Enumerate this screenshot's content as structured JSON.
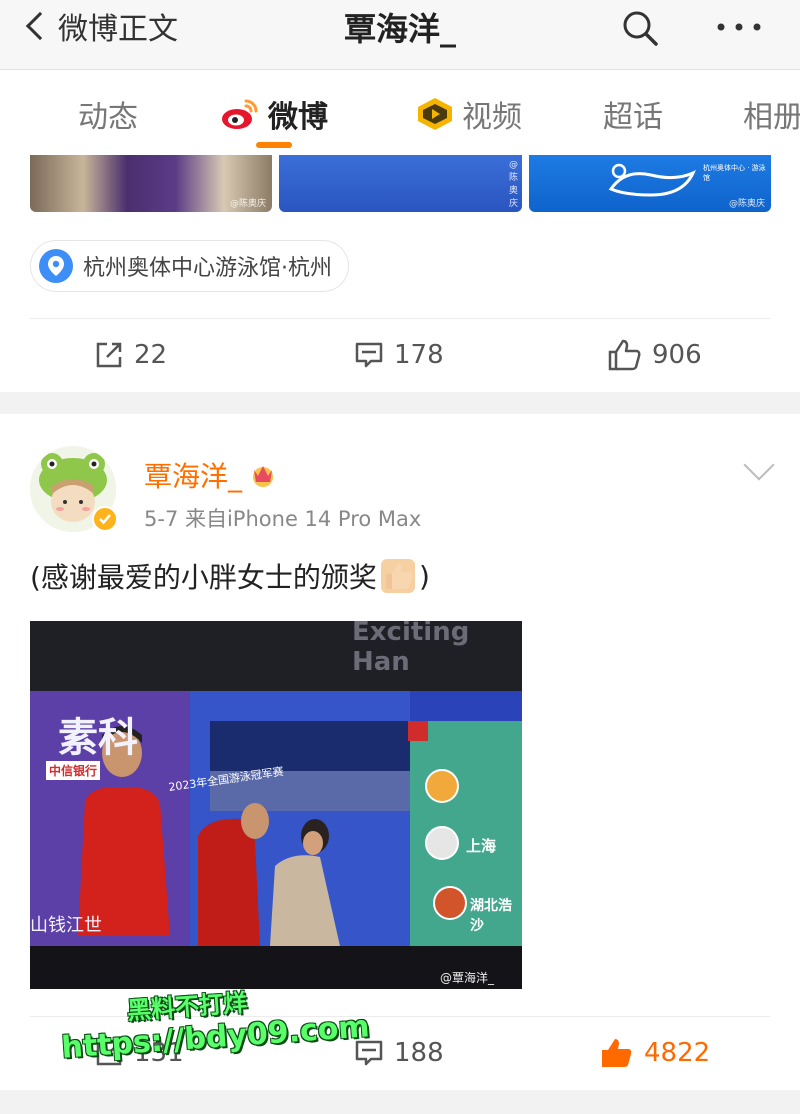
{
  "header": {
    "back_label": "微博正文",
    "title": "覃海洋_"
  },
  "tabs": [
    {
      "label": "动态"
    },
    {
      "label": "微博"
    },
    {
      "label": "视频"
    },
    {
      "label": "超话"
    },
    {
      "label": "相册"
    }
  ],
  "post1": {
    "location": "杭州奥体中心游泳馆·杭州",
    "watermarks": [
      "@陈奥庆",
      "@陈奥庆",
      "@陈奥庆"
    ],
    "banner_text": "杭州奥体中心 · 游泳馆",
    "actions": {
      "repost": "22",
      "comment": "178",
      "like": "906"
    }
  },
  "post2": {
    "username": "覃海洋_",
    "meta": "5-7  来自iPhone 14 Pro Max",
    "text": "(感谢最爱的小胖女士的颁奖",
    "text_end": ")",
    "image": {
      "top_text": "Exciting  Han",
      "board_text": "素科",
      "year_text": "2023年全国游泳冠军赛",
      "bank_text": "中信银行",
      "side_text": "山钱江世",
      "medal_labels": [
        "",
        "上海",
        "湖北浩沙"
      ],
      "watermark": "@覃海洋_"
    },
    "actions": {
      "repost": "131",
      "comment": "188",
      "like": "4822"
    }
  },
  "overlay": {
    "line1": "黑料不打烊",
    "line2": "https://bdy09.com"
  },
  "colors": {
    "accent": "#ff8200",
    "username": "#ff6f00",
    "liked": "#ff6a00",
    "location_pin": "#3e8ef7"
  }
}
